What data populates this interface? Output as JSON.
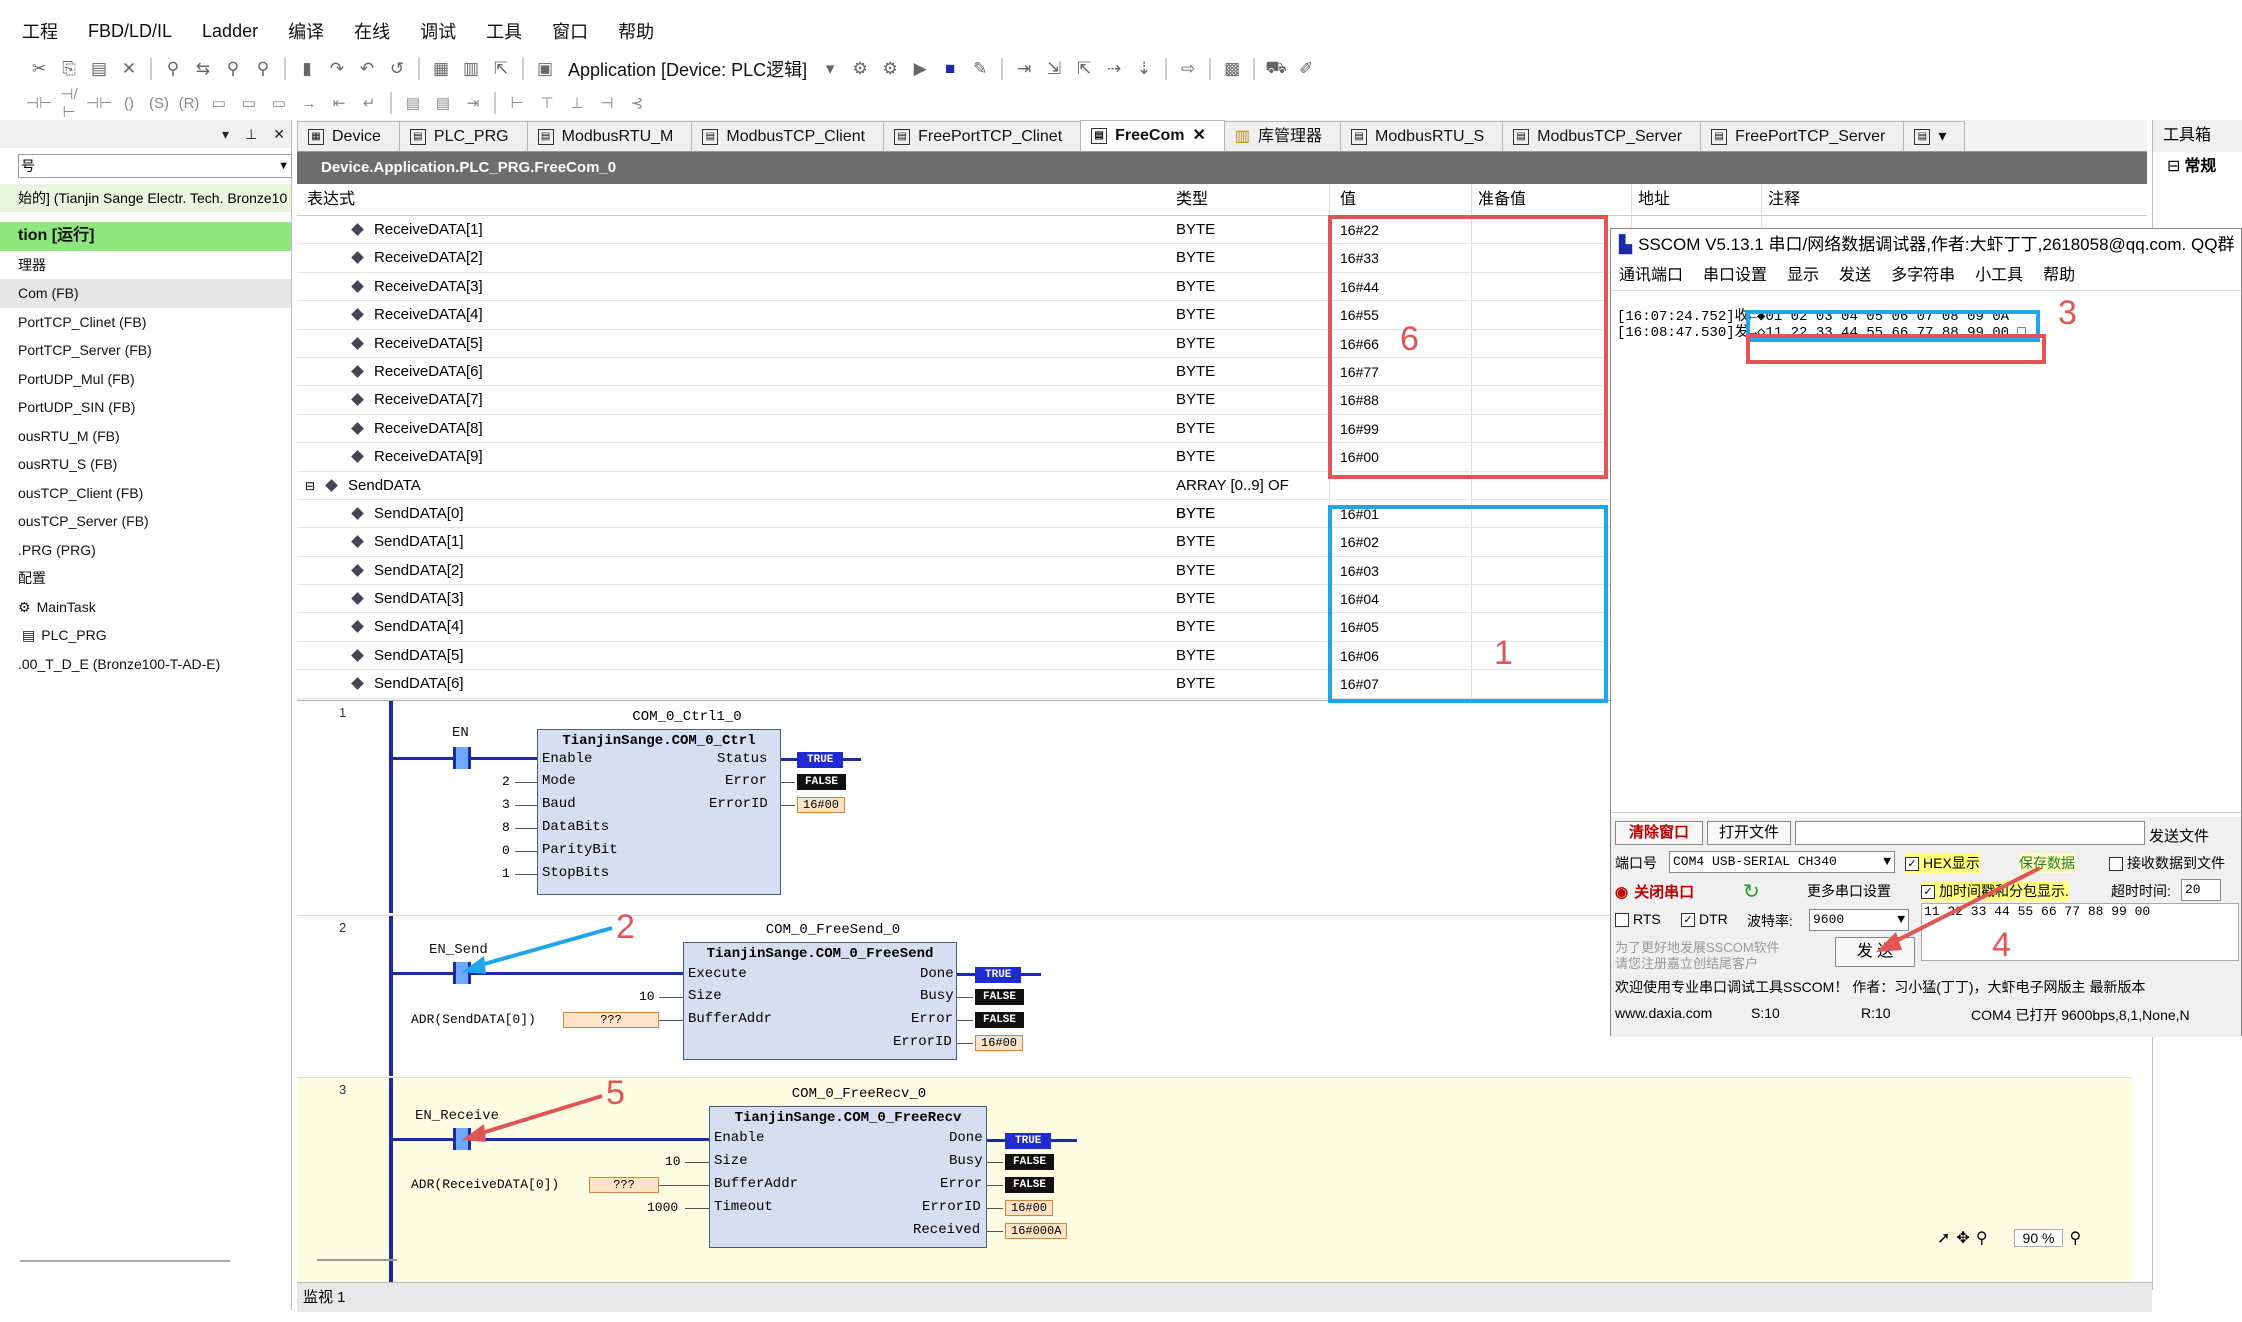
{
  "menu": [
    "工程",
    "FBD/LD/IL",
    "Ladder",
    "编译",
    "在线",
    "调试",
    "工具",
    "窗口",
    "帮助"
  ],
  "toolbar": {
    "app_label": "Application [Device: PLC逻辑]"
  },
  "left_panel": {
    "combo_text": "号",
    "device_text": "始的] (Tianjin Sange Electr. Tech. Bronze10",
    "items": [
      "tion [运行]",
      "理器",
      "Com (FB)",
      "PortTCP_Clinet (FB)",
      "PortTCP_Server (FB)",
      "PortUDP_Mul (FB)",
      "PortUDP_SIN (FB)",
      "ousRTU_M (FB)",
      "ousRTU_S (FB)",
      "ousTCP_Client (FB)",
      "ousTCP_Server (FB)",
      ".PRG (PRG)",
      "配置",
      "MainTask",
      "PLC_PRG",
      ".00_T_D_E (Bronze100-T-AD-E)"
    ]
  },
  "tabs": [
    "Device",
    "PLC_PRG",
    "ModbusRTU_M",
    "ModbusTCP_Client",
    "FreePortTCP_Clinet",
    "FreeCom",
    "库管理器",
    "ModbusRTU_S",
    "ModbusTCP_Server",
    "FreePortTCP_Server"
  ],
  "toolbox": {
    "title": "工具箱",
    "section": "常规"
  },
  "path": "Device.Application.PLC_PRG.FreeCom_0",
  "watch": {
    "headers": {
      "expr": "表达式",
      "type": "类型",
      "value": "值",
      "prepared": "准备值",
      "address": "地址",
      "comment": "注释"
    },
    "rows": [
      {
        "expr": "ReceiveDATA[1]",
        "type": "BYTE",
        "value": "16#22",
        "indent": 2
      },
      {
        "expr": "ReceiveDATA[2]",
        "type": "BYTE",
        "value": "16#33",
        "indent": 2
      },
      {
        "expr": "ReceiveDATA[3]",
        "type": "BYTE",
        "value": "16#44",
        "indent": 2
      },
      {
        "expr": "ReceiveDATA[4]",
        "type": "BYTE",
        "value": "16#55",
        "indent": 2
      },
      {
        "expr": "ReceiveDATA[5]",
        "type": "BYTE",
        "value": "16#66",
        "indent": 2
      },
      {
        "expr": "ReceiveDATA[6]",
        "type": "BYTE",
        "value": "16#77",
        "indent": 2
      },
      {
        "expr": "ReceiveDATA[7]",
        "type": "BYTE",
        "value": "16#88",
        "indent": 2
      },
      {
        "expr": "ReceiveDATA[8]",
        "type": "BYTE",
        "value": "16#99",
        "indent": 2
      },
      {
        "expr": "ReceiveDATA[9]",
        "type": "BYTE",
        "value": "16#00",
        "indent": 2
      },
      {
        "expr": "SendDATA",
        "type": "ARRAY [0..9] OF BYTE",
        "value": "",
        "indent": 1
      },
      {
        "expr": "SendDATA[0]",
        "type": "BYTE",
        "value": "16#01",
        "indent": 2
      },
      {
        "expr": "SendDATA[1]",
        "type": "BYTE",
        "value": "16#02",
        "indent": 2
      },
      {
        "expr": "SendDATA[2]",
        "type": "BYTE",
        "value": "16#03",
        "indent": 2
      },
      {
        "expr": "SendDATA[3]",
        "type": "BYTE",
        "value": "16#04",
        "indent": 2
      },
      {
        "expr": "SendDATA[4]",
        "type": "BYTE",
        "value": "16#05",
        "indent": 2
      },
      {
        "expr": "SendDATA[5]",
        "type": "BYTE",
        "value": "16#06",
        "indent": 2
      },
      {
        "expr": "SendDATA[6]",
        "type": "BYTE",
        "value": "16#07",
        "indent": 2
      }
    ]
  },
  "ladder": {
    "net1": {
      "num": "1",
      "instance": "COM_0_Ctrl1_0",
      "fb_type": "TianjinSange.COM_0_Ctrl",
      "contact": "EN",
      "inputs": [
        {
          "val": "",
          "pin": "Enable"
        },
        {
          "val": "2",
          "pin": "Mode"
        },
        {
          "val": "3",
          "pin": "Baud"
        },
        {
          "val": "8",
          "pin": "DataBits"
        },
        {
          "val": "0",
          "pin": "ParityBit"
        },
        {
          "val": "1",
          "pin": "StopBits"
        }
      ],
      "outputs": [
        {
          "pin": "Status",
          "val": "TRUE"
        },
        {
          "pin": "Error",
          "val": "FALSE"
        },
        {
          "pin": "ErrorID",
          "val": "16#00"
        }
      ]
    },
    "net2": {
      "num": "2",
      "instance": "COM_0_FreeSend_0",
      "fb_type": "TianjinSange.COM_0_FreeSend",
      "contact": "EN_Send",
      "inputs": [
        {
          "val": "",
          "pin": "Execute"
        },
        {
          "val": "10",
          "pin": "Size"
        },
        {
          "val": "ADR(SendDATA[0])",
          "pin": "BufferAddr",
          "box": "???"
        }
      ],
      "outputs": [
        {
          "pin": "Done",
          "val": "TRUE"
        },
        {
          "pin": "Busy",
          "val": "FALSE"
        },
        {
          "pin": "Error",
          "val": "FALSE"
        },
        {
          "pin": "ErrorID",
          "val": "16#00"
        }
      ]
    },
    "net3": {
      "num": "3",
      "instance": "COM_0_FreeRecv_0",
      "fb_type": "TianjinSange.COM_0_FreeRecv",
      "contact": "EN_Receive",
      "inputs": [
        {
          "val": "",
          "pin": "Enable"
        },
        {
          "val": "10",
          "pin": "Size"
        },
        {
          "val": "ADR(ReceiveDATA[0])",
          "pin": "BufferAddr",
          "box": "???"
        },
        {
          "val": "1000",
          "pin": "Timeout"
        }
      ],
      "outputs": [
        {
          "pin": "Done",
          "val": "TRUE"
        },
        {
          "pin": "Busy",
          "val": "FALSE"
        },
        {
          "pin": "Error",
          "val": "FALSE"
        },
        {
          "pin": "ErrorID",
          "val": "16#00"
        },
        {
          "pin": "Received",
          "val": "16#000A"
        }
      ]
    },
    "zoom": "90 %"
  },
  "status": "监视 1",
  "sscom": {
    "title": "SSCOM V5.13.1 串口/网络数据调试器,作者:大虾丁丁,2618058@qq.com. QQ群",
    "menu": [
      "通讯端口",
      "串口设置",
      "显示",
      "发送",
      "多字符串",
      "小工具",
      "帮助"
    ],
    "recv1": "[16:07:24.752]收←◆01 02 03 04 05 06 07 08 09 0A",
    "recv2": "[16:08:47.530]发→◇11 22 33 44 55 66 77 88 99 00 □",
    "clear_btn": "清除窗口",
    "open_file": "打开文件",
    "send_file": "发送文件",
    "port_label": "端口号",
    "port_value": "COM4 USB-SERIAL CH340",
    "hex_display": "HEX显示",
    "save_data": "保存数据",
    "recv_to_file": "接收数据到文件",
    "close_port": "关闭串口",
    "more_settings": "更多串口设置",
    "timestamp": "加时间戳和分包显示.",
    "timeout_label": "超时时间:",
    "timeout_val": "20",
    "rts": "RTS",
    "dtr": "DTR",
    "baud_label": "波特率:",
    "baud_value": "9600",
    "send_text": "11 22 33 44 55 66 77 88 99 00",
    "promo1": "为了更好地发展SSCOM软件",
    "promo2": "请您注册嘉立创结尾客户",
    "send_btn": "发 送",
    "welcome": "欢迎使用专业串口调试工具SSCOM！  作者：习小猛(丁丁)，大虾电子网版主  最新版本",
    "site": "www.daxia.com",
    "s_count": "S:10",
    "r_count": "R:10",
    "port_status": "COM4 已打开  9600bps,8,1,None,N"
  },
  "annotations": {
    "a1": "1",
    "a2": "2",
    "a3": "3",
    "a4": "4",
    "a5": "5",
    "a6": "6"
  },
  "colors": {
    "annotation_red": "#e05555",
    "annotation_blue": "#1ea5ea",
    "ladder_blue": "#1d2aa5",
    "run_green": "#90e67e",
    "fb_fill": "#d5dff0"
  }
}
